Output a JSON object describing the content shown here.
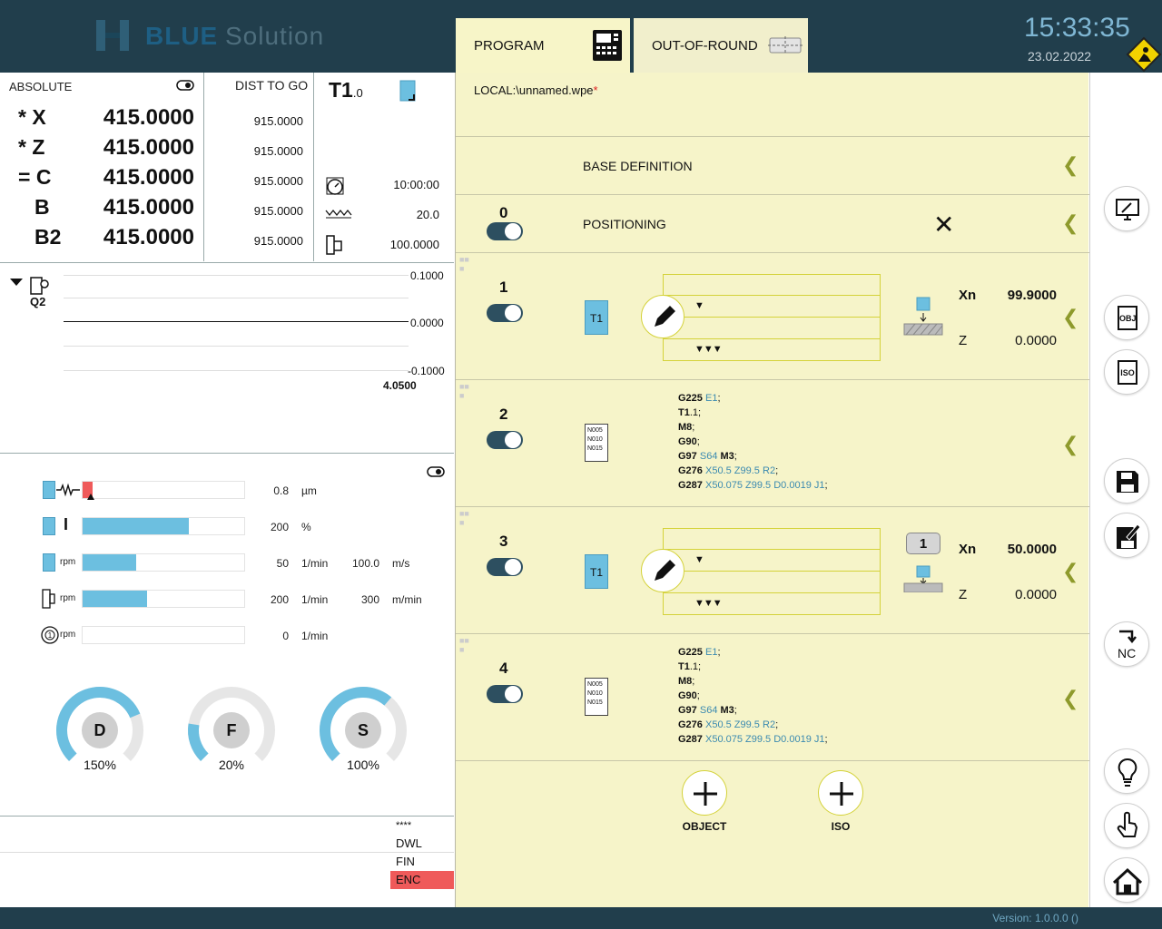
{
  "brand": {
    "name_bold": "BLUE",
    "name_light": "Solution"
  },
  "tabs": [
    {
      "label": "PROGRAM"
    },
    {
      "label": "OUT-OF-ROUND"
    }
  ],
  "clock": {
    "time": "15:33:35",
    "date": "23.02.2022"
  },
  "axes": {
    "header_absolute": "ABSOLUTE",
    "header_dist": "DIST TO GO",
    "rows": [
      {
        "prefix": "*",
        "name": "X",
        "value": "415.0000",
        "dist": "915.0000"
      },
      {
        "prefix": "*",
        "name": "Z",
        "value": "415.0000",
        "dist": "915.0000"
      },
      {
        "prefix": "=",
        "name": "C",
        "value": "415.0000",
        "dist": "915.0000"
      },
      {
        "prefix": "",
        "name": "B",
        "value": "415.0000",
        "dist": "915.0000"
      },
      {
        "prefix": "",
        "name": "B2",
        "value": "415.0000",
        "dist": "915.0000"
      }
    ]
  },
  "tool": {
    "name": "T1",
    "sub": ".0",
    "time": "10:00:00",
    "feed": "20.0",
    "value": "100.0000"
  },
  "probe_chart": {
    "label": "Q2",
    "ymax": "0.1000",
    "ymid": "0.0000",
    "ymin": "-0.1000",
    "xval": "4.0500"
  },
  "gauges": {
    "rows": [
      {
        "value": "0.8",
        "unit": "µm",
        "fill": 0.06,
        "extra": "",
        "extra_unit": ""
      },
      {
        "value": "200",
        "unit": "%",
        "fill": 0.66,
        "extra": "",
        "extra_unit": ""
      },
      {
        "label": "rpm",
        "value": "50",
        "unit": "1/min",
        "fill": 0.33,
        "extra": "100.0",
        "extra_unit": "m/s"
      },
      {
        "label": "rpm",
        "value": "200",
        "unit": "1/min",
        "fill": 0.4,
        "extra": "300",
        "extra_unit": "m/min"
      },
      {
        "label": "rpm",
        "value": "0",
        "unit": "1/min",
        "fill": 0,
        "extra": "",
        "extra_unit": ""
      }
    ],
    "dials": [
      {
        "letter": "D",
        "pct": "150%",
        "fill": 0.75
      },
      {
        "letter": "F",
        "pct": "20%",
        "fill": 0.2
      },
      {
        "letter": "S",
        "pct": "100%",
        "fill": 0.65
      }
    ]
  },
  "status": {
    "stars": "****",
    "dwl": "DWL",
    "fin": "FIN",
    "enc": "ENC"
  },
  "program": {
    "file": "LOCAL:\\unnamed.wpe",
    "file_mark": "*",
    "base_definition": "BASE DEFINITION",
    "positioning_num": "0",
    "positioning": "POSITIONING",
    "rows": [
      {
        "num": "1",
        "type": "tool",
        "tool": "T1",
        "xn_label": "Xn",
        "xn": "99.9000",
        "z_label": "Z",
        "z": "0.0000"
      },
      {
        "num": "2",
        "type": "iso"
      },
      {
        "num": "3",
        "type": "tool",
        "tool": "T1",
        "badge": "1",
        "xn_label": "Xn",
        "xn": "50.0000",
        "z_label": "Z",
        "z": "0.0000"
      },
      {
        "num": "4",
        "type": "iso"
      }
    ],
    "iso_code": [
      "G225",
      "E1",
      "T1",
      ".1",
      "M8",
      "G90",
      "G97",
      "S64",
      "M3",
      "G276",
      "X50.5",
      "Z99.5",
      "R2",
      "G287",
      "X50.075",
      "Z99.5",
      "D0.0019",
      "J1"
    ],
    "doc_lines": [
      "N005",
      "N010",
      "N015"
    ],
    "add_object": "OBJECT",
    "add_iso": "ISO"
  },
  "sidebar": {
    "obj": "OBJ",
    "iso": "ISO",
    "nc": "NC"
  },
  "version": "Version: 1.0.0.0 ()"
}
